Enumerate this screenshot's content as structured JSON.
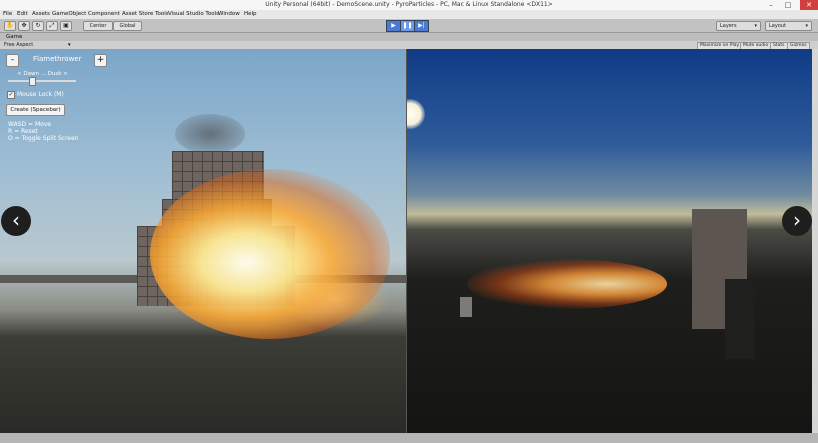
{
  "window": {
    "title": "Unity Personal (64bit) - DemoScene.unity - PyroParticles - PC, Mac & Linux Standalone <DX11>",
    "controls": [
      "–",
      "□",
      "✕"
    ]
  },
  "menu": [
    "File",
    "Edit",
    "Assets",
    "GameObject",
    "Component",
    "Asset Store Tools",
    "Visual Studio Tools",
    "Window",
    "Help"
  ],
  "toolbar": {
    "center_label": "Center",
    "global_label": "Global",
    "layers_label": "Layers",
    "layout_label": "Layout"
  },
  "game_tab": {
    "label": "Game",
    "aspect": "Free Aspect",
    "buttons": [
      "Maximize on Play",
      "Mute audio",
      "Stats",
      "Gizmos"
    ]
  },
  "overlay": {
    "minus": "-",
    "effect_name": "Flamethrower",
    "plus": "+",
    "slider_label": "< Dawn ... Dusk >",
    "slider_value": 0.35,
    "mouse_lock_label": "Mouse Lock (M)",
    "mouse_lock_checked": true,
    "create_button": "Create (Spacebar)",
    "help_lines": [
      "WASD = Move",
      "R = Reset",
      "O = Toggle Split Screen"
    ]
  },
  "nav": {
    "prev_icon": "chevron-left-icon",
    "next_icon": "chevron-right-icon"
  },
  "colors": {
    "play_button": "#4a7ad4",
    "nav_arrow_bg": "#1e1e1e"
  }
}
